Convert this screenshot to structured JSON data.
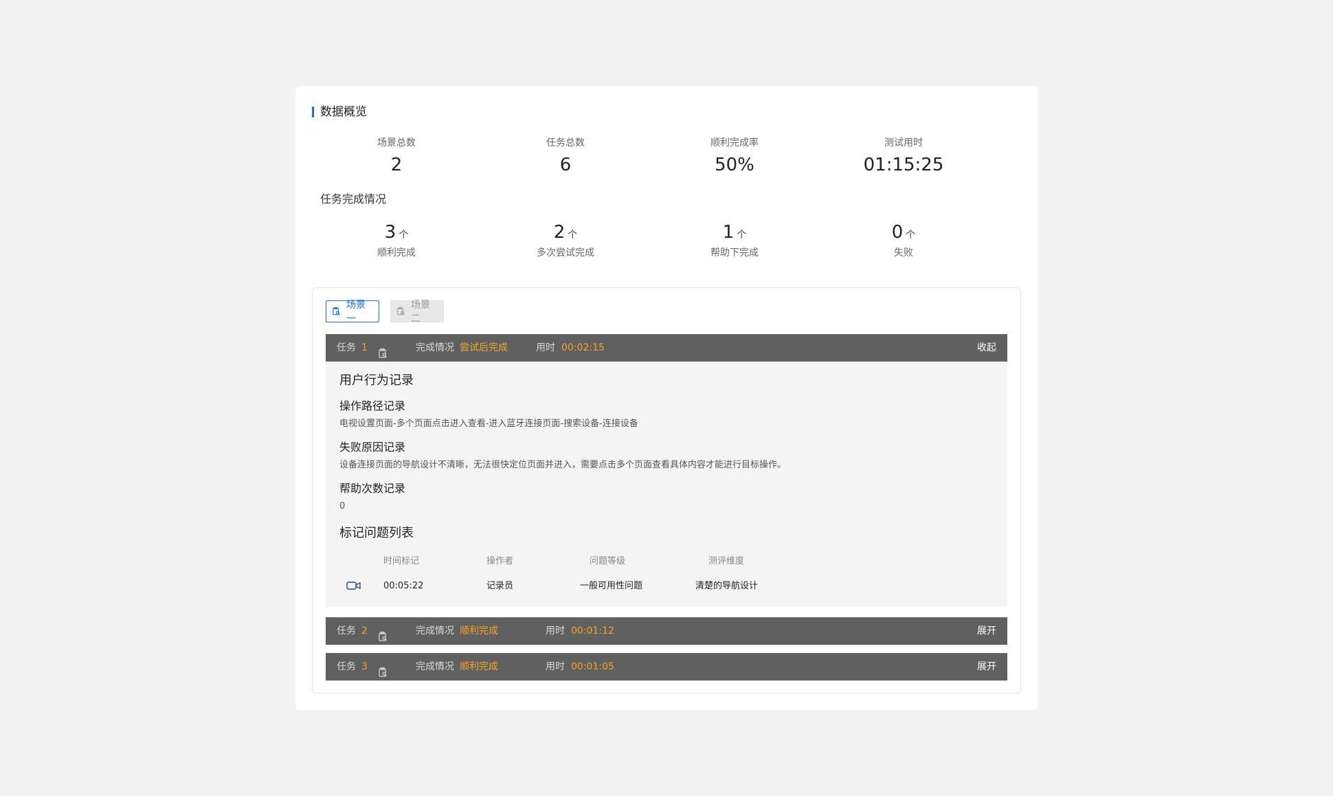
{
  "overview": {
    "title": "数据概览",
    "stats": [
      {
        "label": "场景总数",
        "value": "2"
      },
      {
        "label": "任务总数",
        "value": "6"
      },
      {
        "label": "顺利完成率",
        "value": "50%"
      },
      {
        "label": "测试用时",
        "value": "01:15:25"
      }
    ],
    "completion_title": "任务完成情况",
    "counts": [
      {
        "value": "3",
        "unit": "个",
        "label": "顺利完成"
      },
      {
        "value": "2",
        "unit": "个",
        "label": "多次尝试完成"
      },
      {
        "value": "1",
        "unit": "个",
        "label": "帮助下完成"
      },
      {
        "value": "0",
        "unit": "个",
        "label": "失败"
      }
    ]
  },
  "tabs": [
    {
      "label": "场景一",
      "icon": "clipboard-search-icon"
    },
    {
      "label": "场景二",
      "icon": "clipboard-search-icon"
    }
  ],
  "tasks": [
    {
      "task_label": "任务",
      "num": "1",
      "status_label": "完成情况",
      "status": "尝试后完成",
      "time_label": "用时",
      "time": "00:02:15",
      "toggle": "收起"
    },
    {
      "task_label": "任务",
      "num": "2",
      "status_label": "完成情况",
      "status": "顺利完成",
      "time_label": "用时",
      "time": "00:01:12",
      "toggle": "展开"
    },
    {
      "task_label": "任务",
      "num": "3",
      "status_label": "完成情况",
      "status": "顺利完成",
      "time_label": "用时",
      "time": "00:01:05",
      "toggle": "展开"
    }
  ],
  "detail": {
    "behavior_title": "用户行为记录",
    "path_title": "操作路径记录",
    "path_text": "电视设置页面-多个页面点击进入查看-进入蓝牙连接页面-搜索设备-连接设备",
    "fail_title": "失败原因记录",
    "fail_text": "设备连接页面的导航设计不清晰，无法很快定位页面并进入，需要点击多个页面查看具体内容才能进行目标操作。",
    "help_title": "帮助次数记录",
    "help_text": "0",
    "issues_title": "标记问题列表",
    "columns": [
      "时间标记",
      "操作者",
      "问题等级",
      "测评维度"
    ],
    "rows": [
      {
        "time": "00:05:22",
        "operator": "记录员",
        "level": "一般可用性问题",
        "dimension": "清楚的导航设计"
      }
    ]
  },
  "colors": {
    "accent": "#1f6fe5",
    "highlight": "#f5a623",
    "bar": "#606060"
  }
}
